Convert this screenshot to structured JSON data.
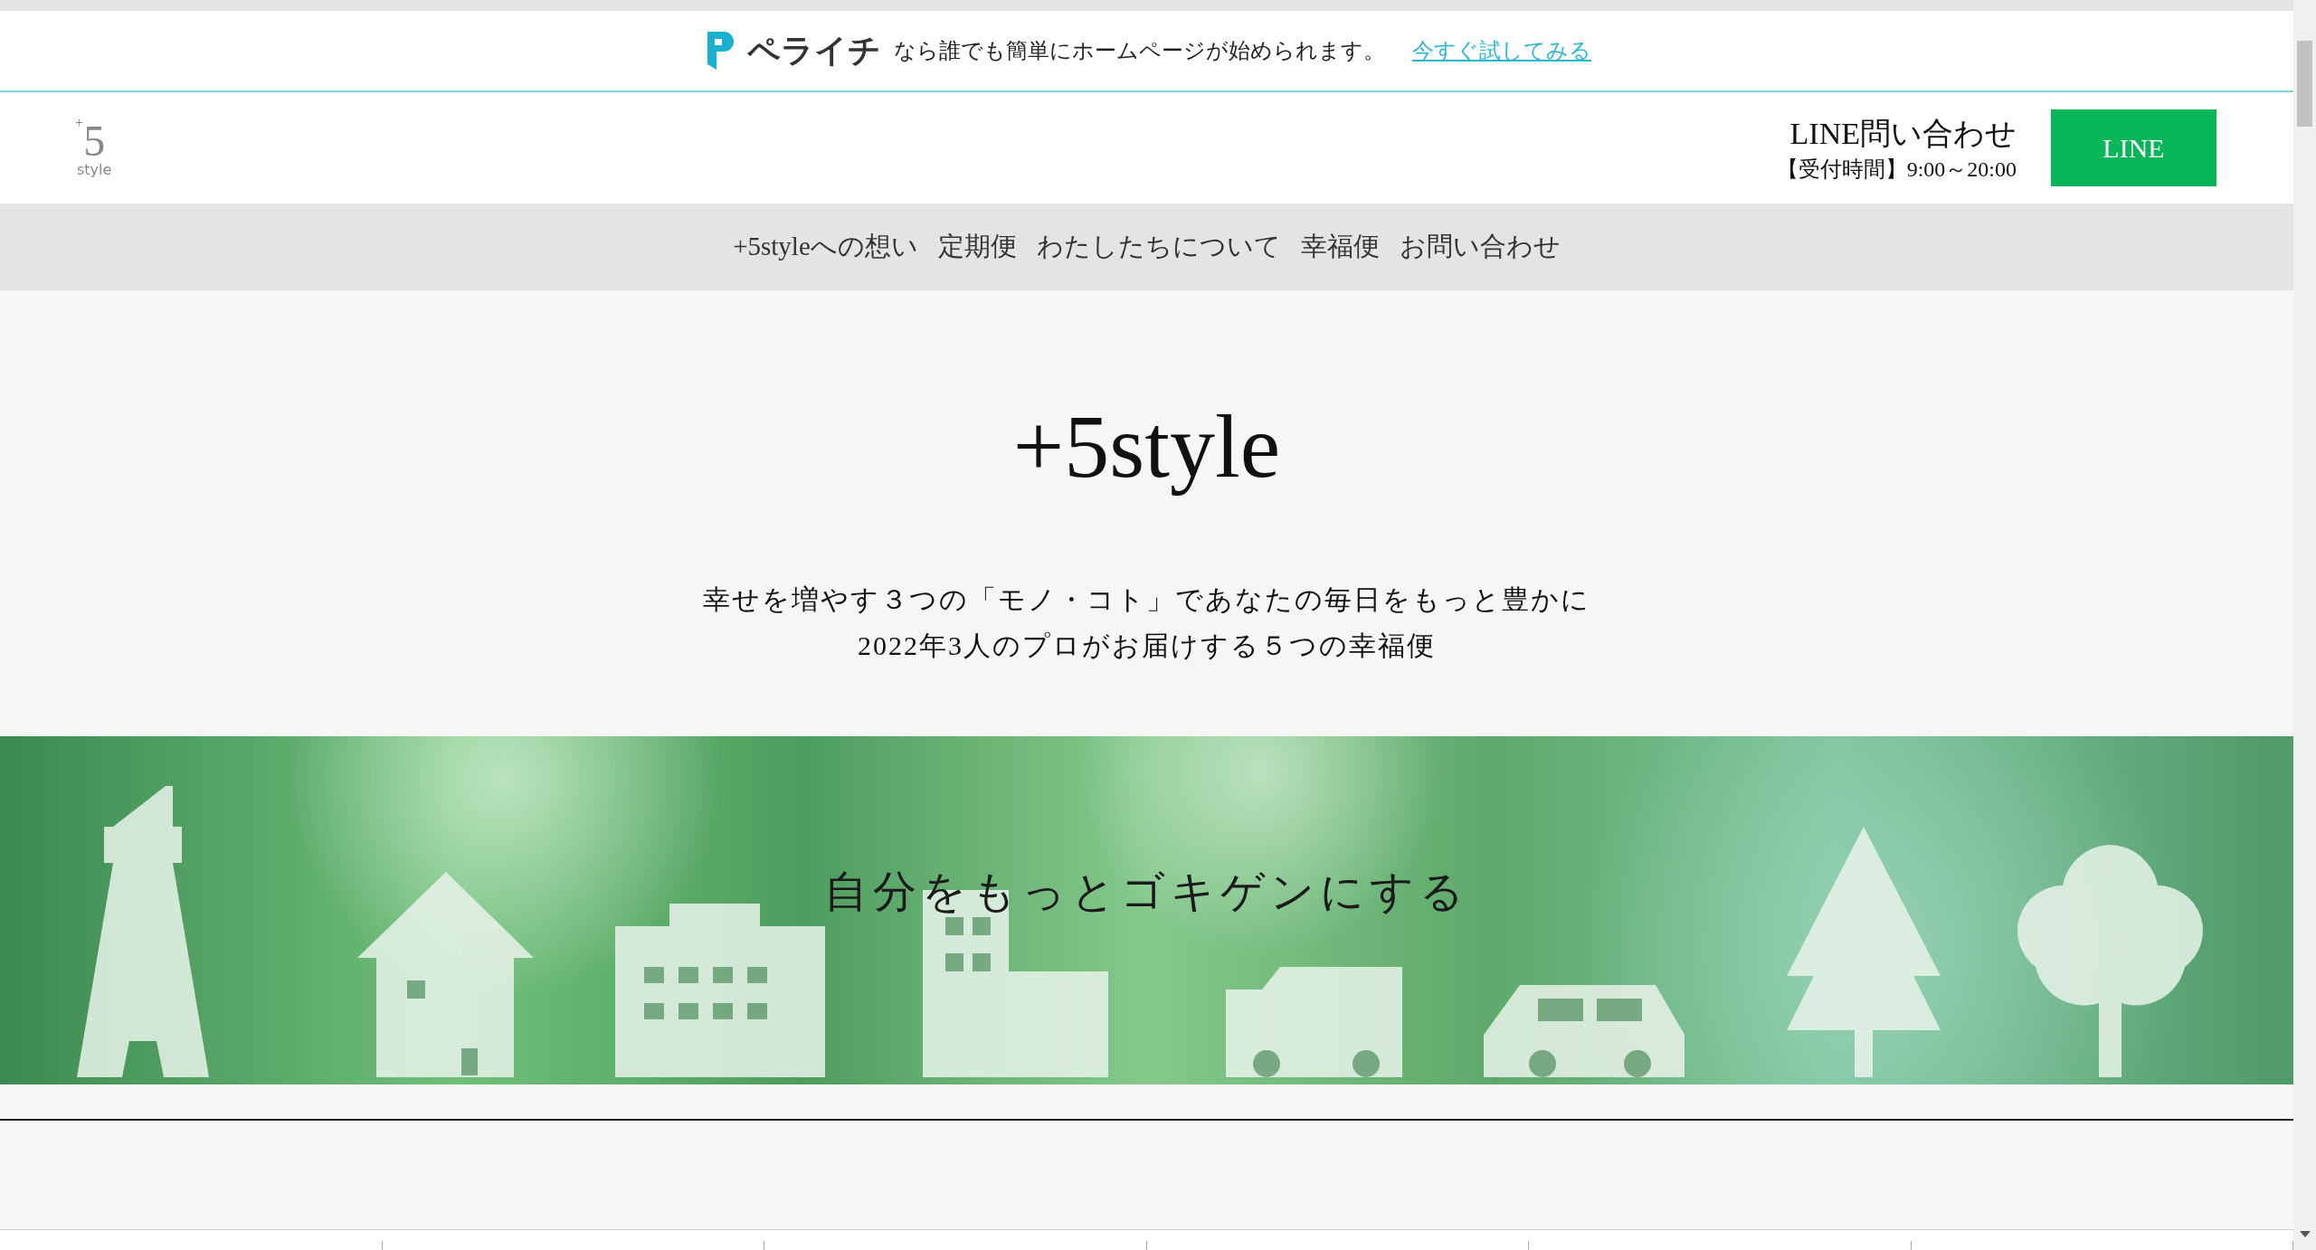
{
  "promo_bar": {
    "brand": "ペライチ",
    "message": "なら誰でも簡単にホームページが始められます。",
    "link": "今すぐ試してみる"
  },
  "header": {
    "logo_mark": "+",
    "logo_number": "5",
    "logo_word": "style",
    "contact_title": "LINE問い合わせ",
    "contact_hours": "【受付時間】9:00～20:00",
    "line_button": "LINE"
  },
  "nav": {
    "items": [
      "+5styleへの想い",
      "定期便",
      "わたしたちについて",
      "幸福便",
      "お問い合わせ"
    ]
  },
  "hero": {
    "title": "+5style",
    "lines": [
      "幸せを増やす３つの「モノ・コト」であなたの毎日をもっと豊かに",
      "2022年3人のプロがお届けする５つの幸福便"
    ]
  },
  "banner": {
    "caption": "自分をもっとゴキゲンにする"
  }
}
